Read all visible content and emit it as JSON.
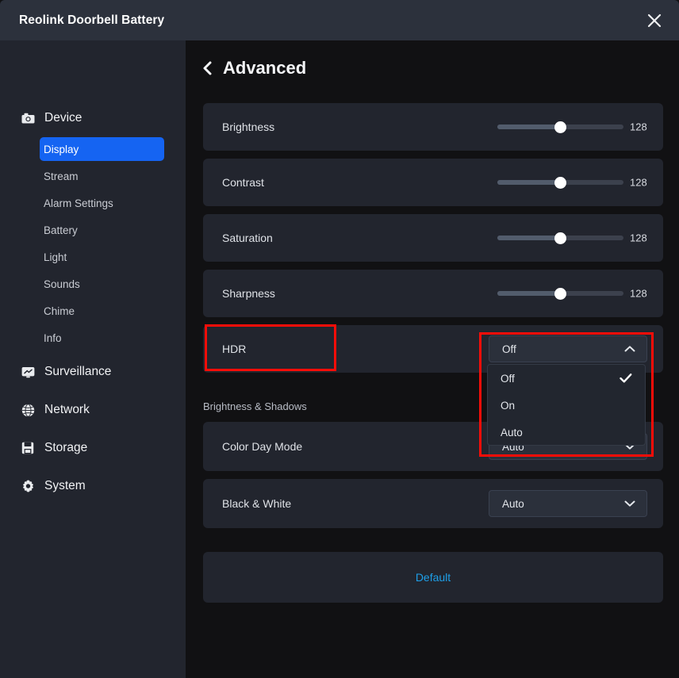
{
  "window": {
    "title": "Reolink Doorbell Battery",
    "close_icon": "close-icon"
  },
  "sidebar": {
    "groups": [
      {
        "label": "Device",
        "icon": "camera-icon",
        "items": [
          {
            "label": "Display",
            "active": true
          },
          {
            "label": "Stream",
            "active": false
          },
          {
            "label": "Alarm Settings",
            "active": false
          },
          {
            "label": "Battery",
            "active": false
          },
          {
            "label": "Light",
            "active": false
          },
          {
            "label": "Sounds",
            "active": false
          },
          {
            "label": "Chime",
            "active": false
          },
          {
            "label": "Info",
            "active": false
          }
        ]
      },
      {
        "label": "Surveillance",
        "icon": "monitor-icon",
        "items": []
      },
      {
        "label": "Network",
        "icon": "globe-icon",
        "items": []
      },
      {
        "label": "Storage",
        "icon": "save-icon",
        "items": []
      },
      {
        "label": "System",
        "icon": "gear-icon",
        "items": []
      }
    ]
  },
  "page": {
    "back_icon": "chevron-left-icon",
    "title": "Advanced"
  },
  "settings": {
    "sliders": [
      {
        "label": "Brightness",
        "value": "128",
        "percent": 50
      },
      {
        "label": "Contrast",
        "value": "128",
        "percent": 50
      },
      {
        "label": "Saturation",
        "value": "128",
        "percent": 50
      },
      {
        "label": "Sharpness",
        "value": "128",
        "percent": 50
      }
    ],
    "hdr": {
      "label": "HDR",
      "selected": "Off",
      "chevron_icon": "chevron-up-icon",
      "options": [
        {
          "label": "Off",
          "checked": true
        },
        {
          "label": "On",
          "checked": false
        },
        {
          "label": "Auto",
          "checked": false
        }
      ],
      "check_icon": "check-icon"
    },
    "section_header": "Brightness & Shadows",
    "color_day_mode": {
      "label": "Color Day Mode",
      "value": "Auto",
      "chevron_icon": "chevron-down-icon"
    },
    "black_white": {
      "label": "Black & White",
      "value": "Auto",
      "chevron_icon": "chevron-down-icon"
    },
    "default_button": "Default"
  },
  "annotations": {
    "accent_color": "#fb0d08",
    "boxes": [
      {
        "name": "hdr-label-highlight"
      },
      {
        "name": "hdr-dropdown-highlight"
      }
    ]
  }
}
